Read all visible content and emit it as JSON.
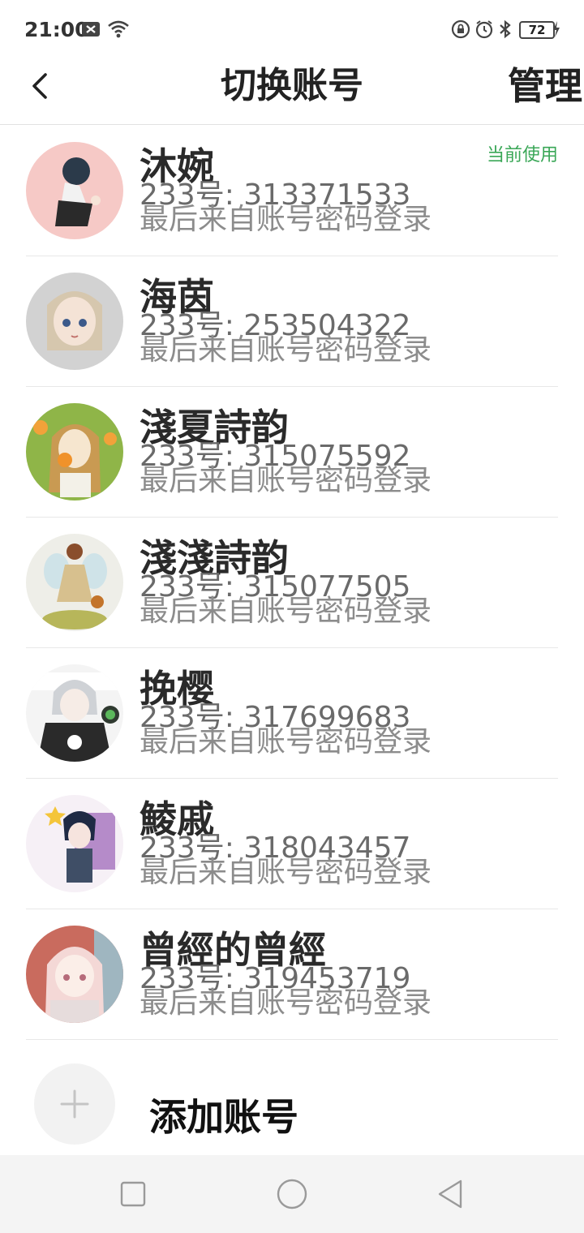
{
  "status_bar": {
    "time": "21:00",
    "battery": "72",
    "icons": [
      "notification-x-icon",
      "wifi-icon",
      "lock-rotation-icon",
      "alarm-icon",
      "bluetooth-icon",
      "battery-icon",
      "charging-icon"
    ]
  },
  "header": {
    "back_icon": "chevron-left-icon",
    "title": "切换账号",
    "manage_label": "管理"
  },
  "accounts": [
    {
      "name": "沐婉",
      "id_text": "233号: 313371533",
      "login_text": "最后来自账号密码登录",
      "current_label": "当前使用"
    },
    {
      "name": "海茵",
      "id_text": "233号: 253504322",
      "login_text": "最后来自账号密码登录"
    },
    {
      "name": "淺夏詩韵",
      "id_text": "233号: 315075592",
      "login_text": "最后来自账号密码登录"
    },
    {
      "name": "淺淺詩韵",
      "id_text": "233号: 315077505",
      "login_text": "最后来自账号密码登录"
    },
    {
      "name": "挽樱",
      "id_text": "233号: 317699683",
      "login_text": "最后来自账号密码登录"
    },
    {
      "name": "鯪戚",
      "id_text": "233号: 318043457",
      "login_text": "最后来自账号密码登录"
    },
    {
      "name": "曾經的曾經",
      "id_text": "233号: 319453719",
      "login_text": "最后来自账号密码登录"
    }
  ],
  "add_account": {
    "icon": "plus-icon",
    "label": "添加账号"
  },
  "nav_bar": {
    "icons": [
      "recents-square-icon",
      "home-circle-icon",
      "back-triangle-icon"
    ]
  },
  "colors": {
    "current_badge": "#3aa757",
    "divider": "#e8e8e8",
    "nav_bg": "#f4f4f4"
  }
}
